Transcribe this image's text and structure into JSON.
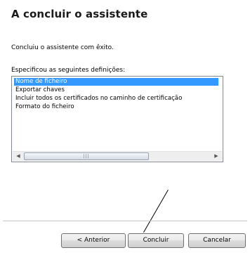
{
  "wizard": {
    "title": "A concluir o assistente",
    "success_message": "Concluiu o assistente com êxito.",
    "settings_label": "Especificou as seguintes definições:"
  },
  "settings_list": {
    "items": [
      "Nome de ficheiro",
      "Exportar chaves",
      "Incluir todos os certificados no caminho de certificação",
      "Formato do ficheiro"
    ],
    "selected_index": 0
  },
  "buttons": {
    "back": "< Anterior",
    "finish": "Concluir",
    "cancel": "Cancelar"
  },
  "colors": {
    "selection": "#3399ff"
  }
}
